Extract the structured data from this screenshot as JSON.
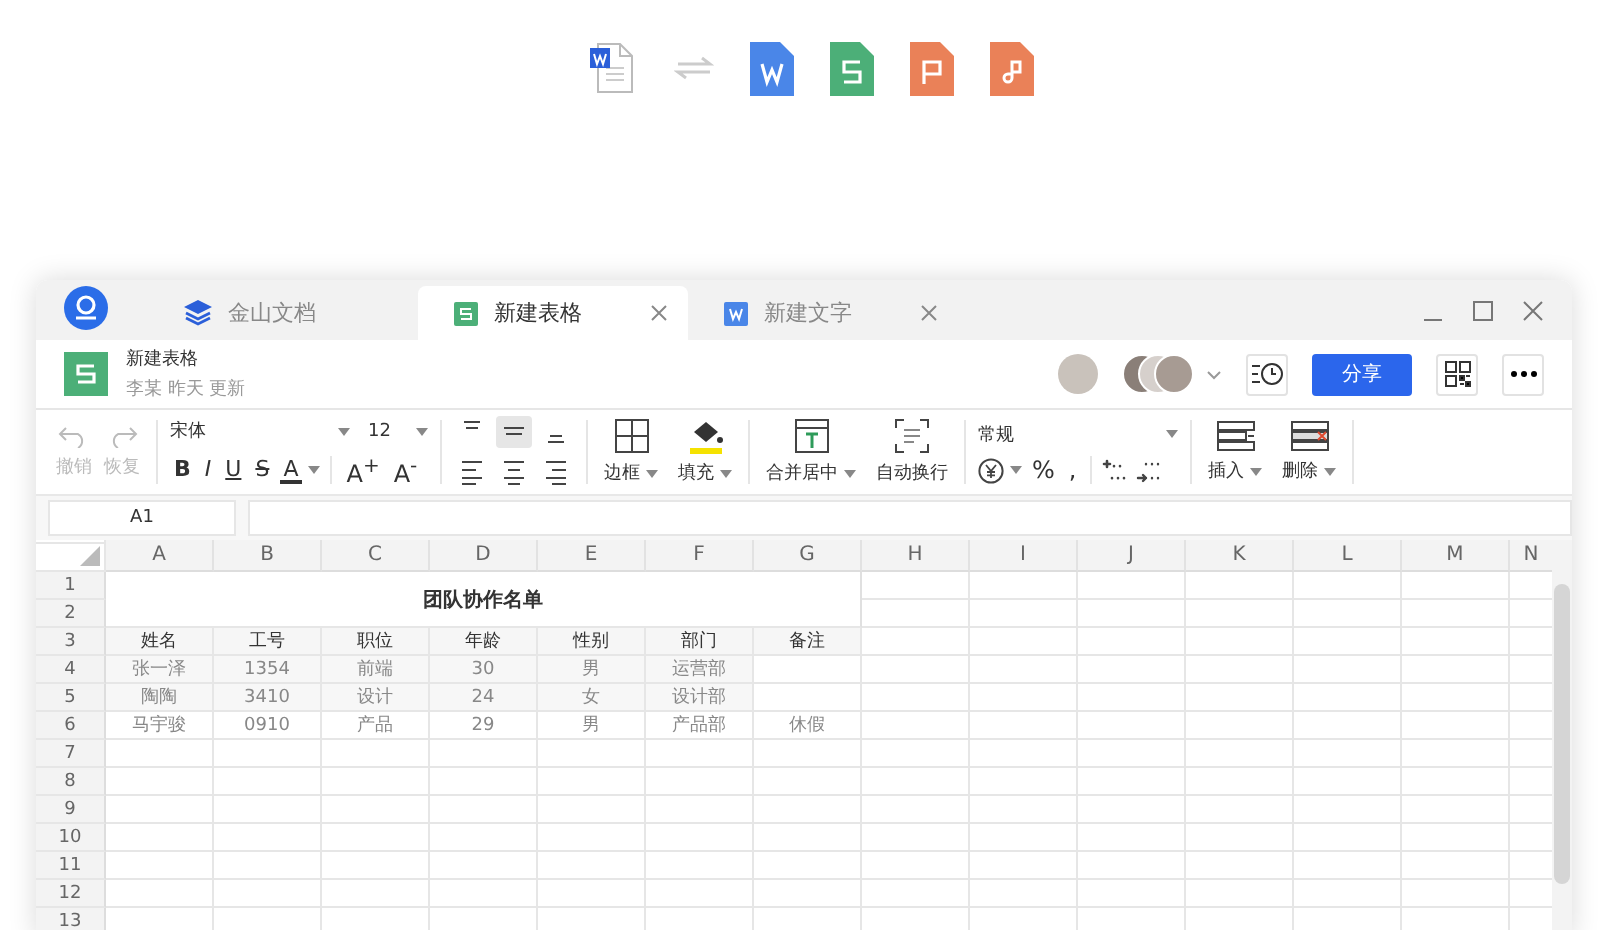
{
  "tabs": [
    {
      "label": "金山文档",
      "kind": "home",
      "selected": false,
      "closable": false
    },
    {
      "label": "新建表格",
      "kind": "sheet",
      "selected": true,
      "closable": true
    },
    {
      "label": "新建文字",
      "kind": "doc",
      "selected": false,
      "closable": true
    }
  ],
  "document": {
    "title": "新建表格",
    "meta": "李某 昨天 更新"
  },
  "share_button": "分享",
  "toolbar": {
    "undo": {
      "label": "撤销",
      "disabled": true
    },
    "redo": {
      "label": "恢复",
      "disabled": true
    },
    "font": "宋体",
    "font_size": "12",
    "style_buttons": [
      "B",
      "I",
      "U",
      "S",
      "A"
    ],
    "size_buttons": [
      "A$^{+}$",
      "A$^{-}$"
    ],
    "border": "边框",
    "fill": "填充",
    "merge": "合并居中",
    "wrap": "自动换行",
    "number_format": "常规",
    "percent": "%",
    "thousands": ",",
    "insert": "插入",
    "delete": "删除"
  },
  "name_box": "A1",
  "sheet": {
    "columns": [
      "A",
      "B",
      "C",
      "D",
      "E",
      "F",
      "G",
      "H",
      "I",
      "J",
      "K",
      "L",
      "M",
      "N"
    ],
    "rows": [
      "1",
      "2",
      "3",
      "4",
      "5",
      "6",
      "7",
      "8",
      "9",
      "10",
      "11",
      "12",
      "13"
    ],
    "title": "团队协作名单",
    "header": [
      "姓名",
      "工号",
      "职位",
      "年龄",
      "性别",
      "部门",
      "备注"
    ],
    "data": [
      {
        "name": "张一泽",
        "id": "1354",
        "position": "前端",
        "age": "30",
        "gender": "男",
        "department": "运营部"
      },
      {
        "name": "陶陶",
        "id": "3410",
        "position": "设计",
        "age": "24",
        "gender": "女",
        "department": "设计部"
      },
      {
        "name": "马宇骏",
        "id": "0910",
        "position": "产品",
        "age": "29",
        "gender": "男",
        "department": "产品部",
        "note": "休假"
      }
    ]
  }
}
